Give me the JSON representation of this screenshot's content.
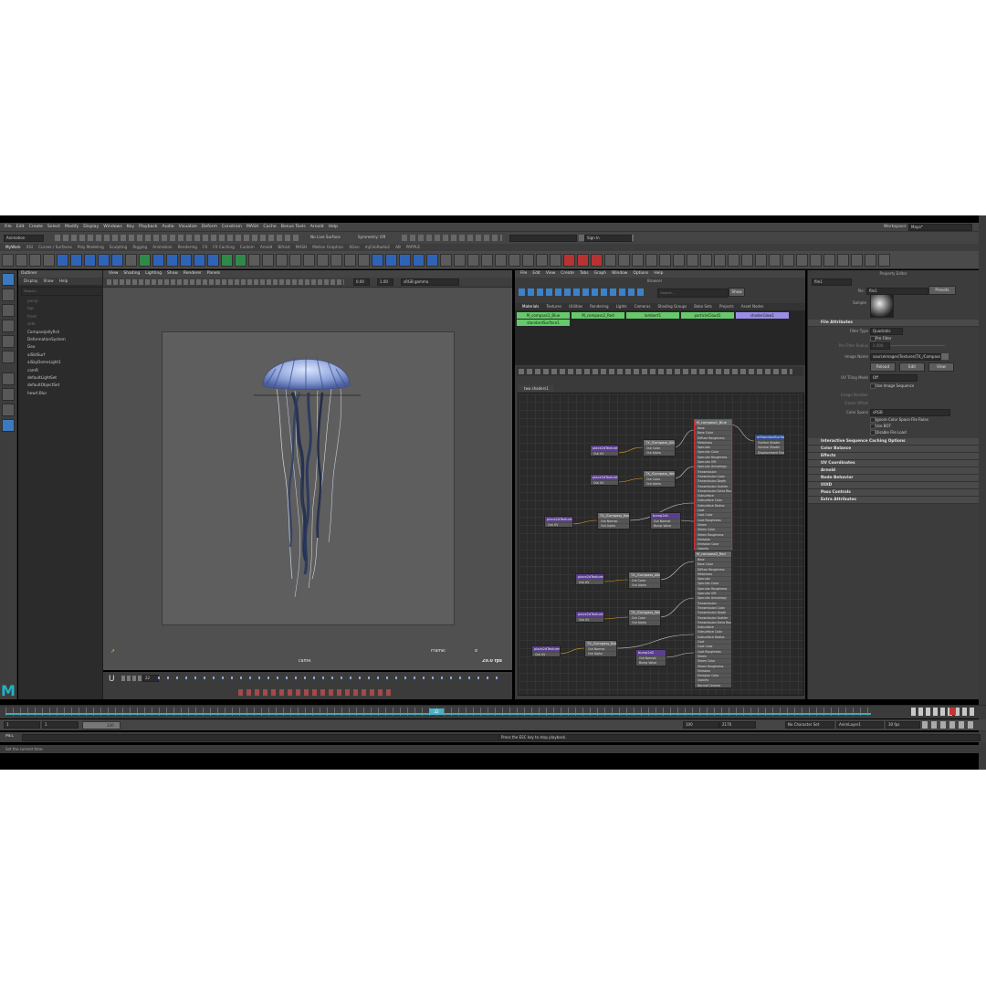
{
  "menubar": [
    "File",
    "Edit",
    "Create",
    "Select",
    "Modify",
    "Display",
    "Windows",
    "Key",
    "Playback",
    "Audio",
    "Visualize",
    "Deform",
    "Constrain",
    "MASH",
    "Cache",
    "Bonus Tools",
    "Arnold",
    "Help"
  ],
  "workspace": {
    "label": "Workspace:",
    "value": "Maya*"
  },
  "statusline": {
    "mode": "Animation",
    "live_surface": "No Live Surface",
    "symmetry": "Symmetry: Off",
    "signin": "Sign In"
  },
  "shelf_tabs": [
    "MyWork",
    "XGI",
    "Curves / Surfaces",
    "Poly Modeling",
    "Sculpting",
    "Rigging",
    "Animation",
    "Rendering",
    "FX",
    "FX Caching",
    "Custom",
    "Arnold",
    "Bifrost",
    "MASH",
    "Motion Graphics",
    "XGen",
    "mjCiloRadio2",
    "AB",
    "PAPPLE"
  ],
  "outliner": {
    "title": "Outliner",
    "menu": [
      "Display",
      "Show",
      "Help"
    ],
    "search_placeholder": "Search...",
    "items": [
      {
        "label": "persp",
        "dim": true
      },
      {
        "label": "top",
        "dim": true
      },
      {
        "label": "front",
        "dim": true
      },
      {
        "label": "side",
        "dim": true
      },
      {
        "label": "CompassJellyfish",
        "dim": false
      },
      {
        "label": "DeformationSystem",
        "dim": false
      },
      {
        "label": "Geo",
        "dim": false
      },
      {
        "label": "aiStdSurf",
        "dim": false
      },
      {
        "label": "aiSkyDomeLight1",
        "dim": false
      },
      {
        "label": "camR",
        "dim": false
      },
      {
        "label": "defaultLightSet",
        "dim": false
      },
      {
        "label": "defaultObjectSet",
        "dim": false
      },
      {
        "label": "hewrl.Blur",
        "dim": false
      }
    ]
  },
  "viewport": {
    "menu": [
      "View",
      "Shading",
      "Lighting",
      "Show",
      "Renderer",
      "Panels"
    ],
    "exposure": "0.00",
    "gamma": "1.00",
    "colorspace": "sRGB gamma",
    "camera": "camR",
    "frame_label": "Frame:",
    "frame_value": "8",
    "fps": "29.0 fps"
  },
  "playback_small": {
    "current": "22"
  },
  "node_editor": {
    "menu": [
      "File",
      "Edit",
      "View",
      "Create",
      "Tabs",
      "Graph",
      "Window",
      "Options",
      "Help"
    ],
    "title": "Hypershade",
    "browser_label": "Browser",
    "search_placeholder": "Search...",
    "show_btn": "Show",
    "hyper_tabs": [
      "Materials",
      "Textures",
      "Utilities",
      "Rendering",
      "Lights",
      "Cameras",
      "Shading Groups",
      "Bake Sets",
      "Projects",
      "Asset Nodes"
    ],
    "swatches": [
      {
        "label": "M_compass1_Blue",
        "color": "#67c96b"
      },
      {
        "label": "M_compass2_Red",
        "color": "#67c96b"
      },
      {
        "label": "lambert1",
        "color": "#67c96b"
      },
      {
        "label": "particleCloud1",
        "color": "#67c96b"
      },
      {
        "label": "shaderGlow1",
        "color": "#9a8de8"
      },
      {
        "label": "standardSurface1",
        "color": "#67c96b"
      }
    ],
    "graph_tab": "two shaders1"
  },
  "nodes": {
    "shader_top": {
      "title": "M_compass1_Blue",
      "out": "Out Color"
    },
    "shader_bottom": {
      "title": "M_compass2_Red",
      "out": "Out Color"
    },
    "sg": {
      "title": "aiStandardSurface1SG",
      "rows": [
        "Surface Shader",
        "Volume Shader",
        "Displacement Shader"
      ]
    },
    "tex": [
      {
        "title": "TX_/Compass_Albedo.png",
        "a": "Out Color",
        "b": "Out Alpha"
      },
      {
        "title": "TX_/Compass_Weight.png",
        "a": "Out Color",
        "b": "Out Alpha"
      },
      {
        "title": "TX_/Compass_Normal.png",
        "a": "Out Normal",
        "b": "Out Alpha"
      },
      {
        "title": "TX_/Compass_Albedo2.png",
        "a": "Out Color",
        "b": "Out Alpha"
      },
      {
        "title": "TX_/Compass_Weight2.png",
        "a": "Out Color",
        "b": "Out Alpha"
      },
      {
        "title": "TX_/Compass_Normal2.png",
        "a": "Out Normal",
        "b": "Out Alpha"
      }
    ],
    "place": [
      {
        "title": "place2dTexture1",
        "out": "Out UV"
      },
      {
        "title": "place2dTexture2",
        "out": "Out UV"
      },
      {
        "title": "place2dTexture3",
        "out": "Out UV"
      },
      {
        "title": "place2dTexture4",
        "out": "Out UV"
      },
      {
        "title": "place2dTexture5",
        "out": "Out UV"
      },
      {
        "title": "place2dTexture6",
        "out": "Out UV"
      }
    ],
    "bump": [
      {
        "title": "bump2d1",
        "out": "Out Normal",
        "row": "Bump Value"
      },
      {
        "title": "bump2d2",
        "out": "Out Normal",
        "row": "Bump Value"
      }
    ],
    "shader_rows": [
      "Base",
      "Base Color",
      "Diffuse Roughness",
      "Metalness",
      "Specular",
      "Specular Color",
      "Specular Roughness",
      "Specular IOR",
      "Specular Anisotropy",
      "Transmission",
      "Transmission Color",
      "Transmission Depth",
      "Transmission Scatter",
      "Transmission Extra Roughness",
      "Subsurface",
      "Subsurface Color",
      "Subsurface Radius",
      "Coat",
      "Coat Color",
      "Coat Roughness",
      "Sheen",
      "Sheen Color",
      "Sheen Roughness",
      "Emission",
      "Emission Color",
      "Opacity",
      "Normal Camera"
    ]
  },
  "attr_editor": {
    "title": "Property Editor",
    "node_name": "file1",
    "file_label": "file:",
    "file_value": "file1",
    "presets": "Presets",
    "sample": "Sample",
    "sections": [
      {
        "label": "File Attributes",
        "open": true
      },
      {
        "label": "Interactive Sequence Caching Options",
        "open": false
      },
      {
        "label": "Color Balance",
        "open": false
      },
      {
        "label": "Effects",
        "open": false
      },
      {
        "label": "UV Coordinates",
        "open": false
      },
      {
        "label": "Arnold",
        "open": false
      },
      {
        "label": "Node Behavior",
        "open": false
      },
      {
        "label": "UUID",
        "open": false
      },
      {
        "label": "Pass Controls",
        "open": false
      },
      {
        "label": "Extra Attributes",
        "open": false
      }
    ],
    "filter_type_label": "Filter Type",
    "filter_type": "Quadratic",
    "pre_filter": "Pre Filter",
    "pre_filter_radius": "Pre Filter Radius",
    "pre_filter_value": "2.000",
    "image_name_label": "Image Name",
    "image_name": "sourceimages\\Textures\\TX_/Compass_Albedo.png",
    "reload": "Reload",
    "edit": "Edit",
    "view": "View",
    "uv_tiling_label": "UV Tiling Mode",
    "uv_tiling": "Off",
    "use_image_seq": "Use Image Sequence",
    "image_number": "Image Number",
    "frame_offset": "Frame Offset",
    "color_space_label": "Color Space",
    "color_space": "sRGB",
    "ignore_rules": "Ignore Color Space File Rules",
    "use_bot": "Use BOT",
    "disable_load": "Disable File Load"
  },
  "timeline": {
    "start": "1",
    "end": "120",
    "current_marker": "22",
    "fps": "30 fps"
  },
  "range": {
    "start": "1",
    "inner_start": "1",
    "inner_end": "120",
    "end_a": "100",
    "end_b": "2176",
    "char_set": "No Character Set",
    "anim_layer": "AnimLayer1"
  },
  "cmdline": {
    "lang": "MEL",
    "message": "Press the ESC key to stop playback."
  },
  "helpline": {
    "text": "Set the current time."
  }
}
